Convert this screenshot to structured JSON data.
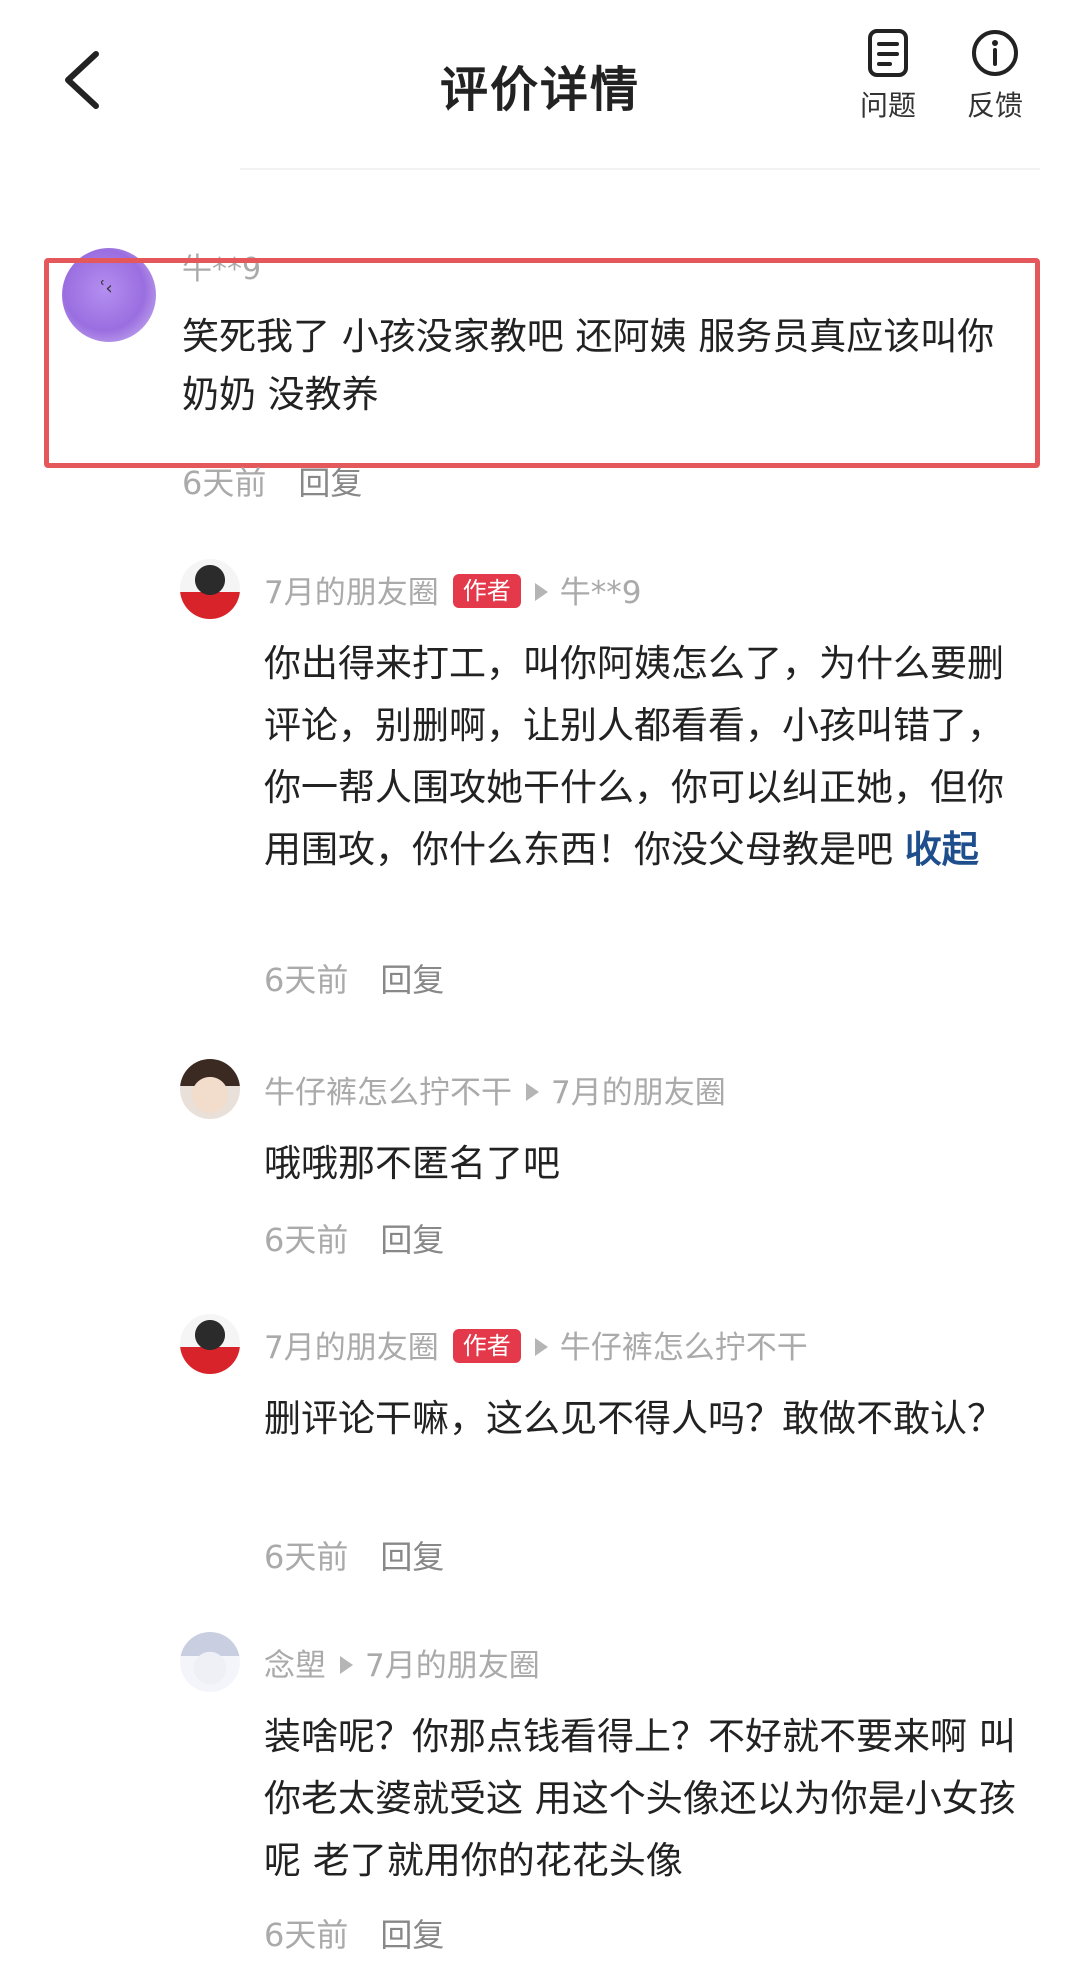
{
  "header": {
    "title": "评价详情",
    "back_icon": "chevron-left-icon",
    "problem_label": "问题",
    "feedback_label": "反馈"
  },
  "main_comment": {
    "username": "牛**9",
    "text": "笑死我了 小孩没家教吧 还阿姨 服务员真应该叫你奶奶 没教养",
    "time": "6天前",
    "reply_label": "回复"
  },
  "replies": [
    {
      "username": "7月的朋友圈",
      "badge": "作者",
      "reply_to": "牛**9",
      "text": "你出得来打工，叫你阿姨怎么了，为什么要删评论，别删啊，让别人都看看，小孩叫错了，你一帮人围攻她干什么，你可以纠正她，但你用围攻，你什么东西！你没父母教是吧",
      "collapse_label": "收起",
      "time": "6天前",
      "reply_label": "回复"
    },
    {
      "username": "牛仔裤怎么拧不干",
      "reply_to": "7月的朋友圈",
      "text": "哦哦那不匿名了吧",
      "time": "6天前",
      "reply_label": "回复"
    },
    {
      "username": "7月的朋友圈",
      "badge": "作者",
      "reply_to": "牛仔裤怎么拧不干",
      "text": "删评论干嘛，这么见不得人吗？敢做不敢认？",
      "time": "6天前",
      "reply_label": "回复"
    },
    {
      "username": "念塱",
      "reply_to": "7月的朋友圈",
      "text": "装啥呢？你那点钱看得上？不好就不要来啊 叫你老太婆就受这 用这个头像还以为你是小女孩呢 老了就用你的花花头像",
      "time": "6天前",
      "reply_label": "回复"
    }
  ],
  "colors": {
    "highlight_border": "#e4575a",
    "author_badge": "#e4394a",
    "collapse_link": "#1f4e8c"
  }
}
